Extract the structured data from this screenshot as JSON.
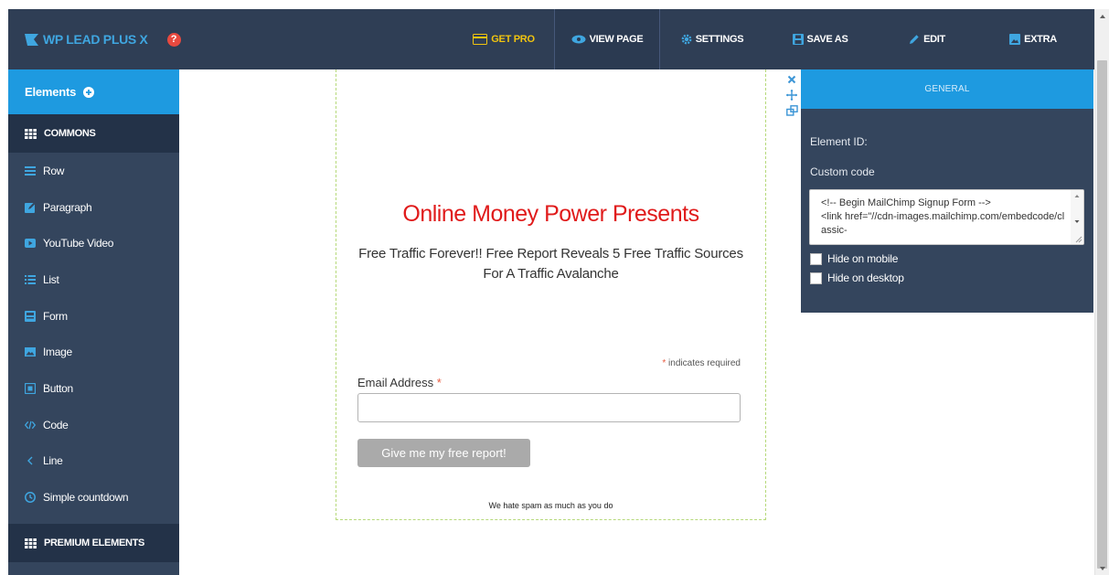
{
  "topbar": {
    "logo_text": "WP LEAD PLUS X",
    "help_glyph": "?",
    "nav": {
      "get_pro": "GET PRO",
      "view_page": "VIEW PAGE",
      "settings": "SETTINGS",
      "save_as": "SAVE AS",
      "edit": "EDIT",
      "extra": "EXTRA"
    }
  },
  "sidebar": {
    "header": "Elements",
    "section_commons": "COMMONS",
    "items": [
      {
        "label": "Row",
        "icon": "bars-icon"
      },
      {
        "label": "Paragraph",
        "icon": "edit-icon"
      },
      {
        "label": "YouTube Video",
        "icon": "video-icon"
      },
      {
        "label": "List",
        "icon": "list-icon"
      },
      {
        "label": "Form",
        "icon": "form-icon"
      },
      {
        "label": "Image",
        "icon": "image-icon"
      },
      {
        "label": "Button",
        "icon": "button-icon"
      },
      {
        "label": "Code",
        "icon": "code-icon"
      },
      {
        "label": "Line",
        "icon": "line-icon"
      },
      {
        "label": "Simple countdown",
        "icon": "clock-icon"
      }
    ],
    "section_premium": "PREMIUM ELEMENTS"
  },
  "page": {
    "headline": "Online Money Power Presents",
    "subheadline": "Free Traffic Forever!! Free Report Reveals 5 Free Traffic Sources For A Traffic Avalanche",
    "required_star": "*",
    "required_note": " indicates required",
    "email_label": "Email Address ",
    "email_value": "",
    "submit_label": "Give me my free report!",
    "spam_note": "We hate spam as much as you do"
  },
  "panel": {
    "tab": "GENERAL",
    "element_id_label": "Element ID:",
    "custom_code_label": "Custom code",
    "custom_code_value": "<!-- Begin MailChimp Signup Form -->\n<link href=\"//cdn-images.mailchimp.com/embedcode/classic-",
    "hide_mobile": "Hide on mobile",
    "hide_desktop": "Hide on desktop"
  },
  "colors": {
    "topbar": "#2f3e55",
    "sidebar": "#34455d",
    "accent": "#1e9ae0",
    "headline": "#e01b1b",
    "get_pro": "#f1c40f"
  }
}
